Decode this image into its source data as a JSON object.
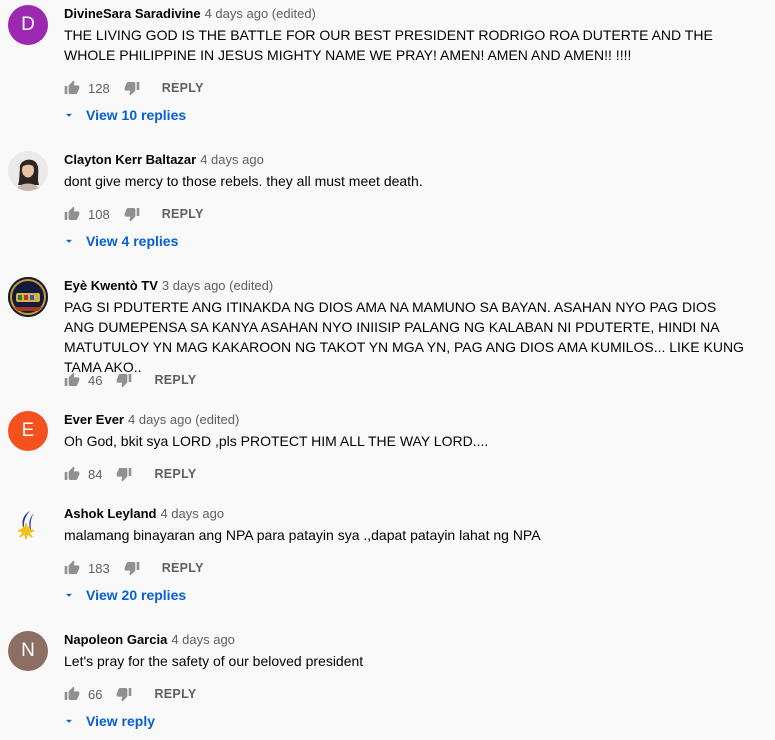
{
  "comments": [
    {
      "author": "DivineSara Saradivine",
      "time": "4 days ago (edited)",
      "avatar_letter": "D",
      "avatar_color": "#9c27b0",
      "text": "THE LIVING GOD IS THE BATTLE FOR OUR BEST PRESIDENT RODRIGO ROA DUTERTE AND THE WHOLE PHILIPPINE IN JESUS MIGHTY NAME WE PRAY! AMEN! AMEN AND AMEN!! !!!!",
      "likes": "128",
      "reply_label": "REPLY",
      "view_replies": "View 10 replies"
    },
    {
      "author": "Clayton Kerr Baltazar",
      "time": "4 days ago",
      "avatar_letter": "",
      "avatar_color": "#e9e6e4",
      "text": "dont give mercy to those rebels. they all must meet death.",
      "likes": "108",
      "reply_label": "REPLY",
      "view_replies": "View 4 replies"
    },
    {
      "author": "Eyè Kwentò TV",
      "time": "3 days ago (edited)",
      "avatar_letter": "",
      "avatar_color": "#1a1f4a",
      "text": "PAG SI PDUTERTE ANG ITINAKDA NG DIOS AMA NA MAMUNO SA BAYAN. ASAHAN NYO PAG DIOS ANG DUMEPENSA SA KANYA ASAHAN NYO INIISIP PALANG NG KALABAN NI PDUTERTE, HINDI NA MATUTULOY YN MAG KAKAROON NG TAKOT YN MGA YN, PAG ANG DIOS AMA KUMILOS... LIKE KUNG TAMA AKO..",
      "likes": "46",
      "reply_label": "REPLY",
      "view_replies": ""
    },
    {
      "author": "Ever Ever",
      "time": "4 days ago (edited)",
      "avatar_letter": "E",
      "avatar_color": "#f4511e",
      "text": "Oh God, bkit sya LORD ,pls PROTECT HIM ALL THE WAY LORD....",
      "likes": "84",
      "reply_label": "REPLY",
      "view_replies": ""
    },
    {
      "author": "Ashok Leyland",
      "time": "4 days ago",
      "avatar_letter": "",
      "avatar_color": "#ffffff",
      "text": "malamang binayaran ang NPA  para patayin sya .,dapat  patayin lahat ng NPA",
      "likes": "183",
      "reply_label": "REPLY",
      "view_replies": "View 20 replies"
    },
    {
      "author": "Napoleon Garcia",
      "time": "4 days ago",
      "avatar_letter": "N",
      "avatar_color": "#8d6e63",
      "text": "Let's pray for the safety of our beloved president",
      "likes": "66",
      "reply_label": "REPLY",
      "view_replies": "View reply"
    }
  ],
  "icons": {
    "like": "thumbs-up-icon",
    "dislike": "thumbs-down-icon",
    "expand": "caret-down-icon"
  },
  "colors": {
    "link": "#065fd4",
    "secondary_text": "#606060",
    "background": "#f9f9f9"
  }
}
